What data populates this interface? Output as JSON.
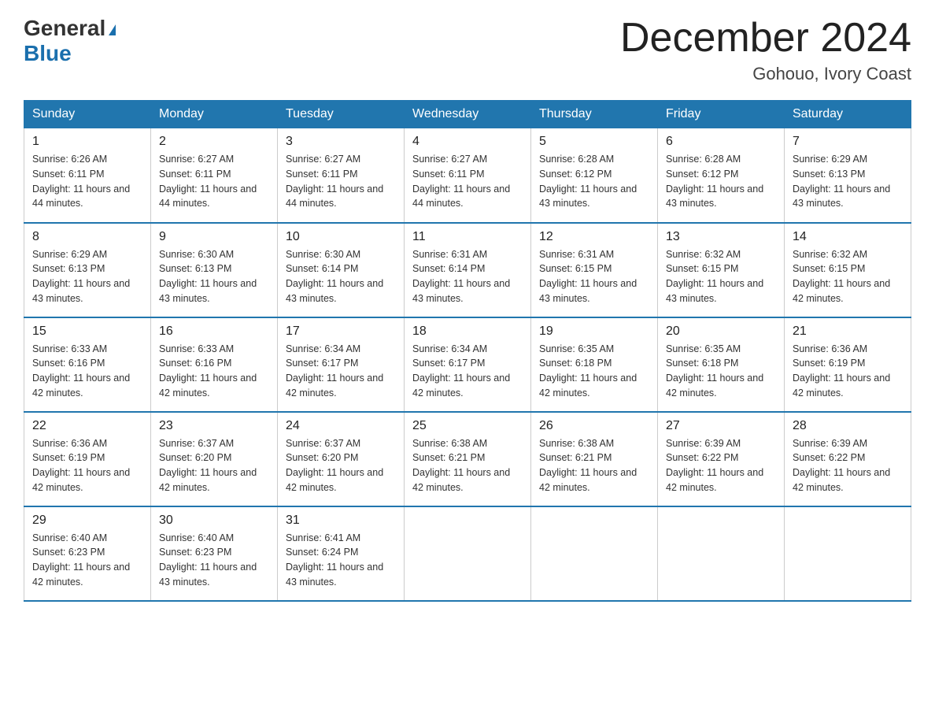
{
  "logo": {
    "general": "General",
    "blue": "Blue",
    "arrow": "▶"
  },
  "title": "December 2024",
  "subtitle": "Gohouo, Ivory Coast",
  "weekdays": [
    "Sunday",
    "Monday",
    "Tuesday",
    "Wednesday",
    "Thursday",
    "Friday",
    "Saturday"
  ],
  "weeks": [
    [
      {
        "day": 1,
        "sunrise": "6:26 AM",
        "sunset": "6:11 PM",
        "daylight": "11 hours and 44 minutes."
      },
      {
        "day": 2,
        "sunrise": "6:27 AM",
        "sunset": "6:11 PM",
        "daylight": "11 hours and 44 minutes."
      },
      {
        "day": 3,
        "sunrise": "6:27 AM",
        "sunset": "6:11 PM",
        "daylight": "11 hours and 44 minutes."
      },
      {
        "day": 4,
        "sunrise": "6:27 AM",
        "sunset": "6:11 PM",
        "daylight": "11 hours and 44 minutes."
      },
      {
        "day": 5,
        "sunrise": "6:28 AM",
        "sunset": "6:12 PM",
        "daylight": "11 hours and 43 minutes."
      },
      {
        "day": 6,
        "sunrise": "6:28 AM",
        "sunset": "6:12 PM",
        "daylight": "11 hours and 43 minutes."
      },
      {
        "day": 7,
        "sunrise": "6:29 AM",
        "sunset": "6:13 PM",
        "daylight": "11 hours and 43 minutes."
      }
    ],
    [
      {
        "day": 8,
        "sunrise": "6:29 AM",
        "sunset": "6:13 PM",
        "daylight": "11 hours and 43 minutes."
      },
      {
        "day": 9,
        "sunrise": "6:30 AM",
        "sunset": "6:13 PM",
        "daylight": "11 hours and 43 minutes."
      },
      {
        "day": 10,
        "sunrise": "6:30 AM",
        "sunset": "6:14 PM",
        "daylight": "11 hours and 43 minutes."
      },
      {
        "day": 11,
        "sunrise": "6:31 AM",
        "sunset": "6:14 PM",
        "daylight": "11 hours and 43 minutes."
      },
      {
        "day": 12,
        "sunrise": "6:31 AM",
        "sunset": "6:15 PM",
        "daylight": "11 hours and 43 minutes."
      },
      {
        "day": 13,
        "sunrise": "6:32 AM",
        "sunset": "6:15 PM",
        "daylight": "11 hours and 43 minutes."
      },
      {
        "day": 14,
        "sunrise": "6:32 AM",
        "sunset": "6:15 PM",
        "daylight": "11 hours and 42 minutes."
      }
    ],
    [
      {
        "day": 15,
        "sunrise": "6:33 AM",
        "sunset": "6:16 PM",
        "daylight": "11 hours and 42 minutes."
      },
      {
        "day": 16,
        "sunrise": "6:33 AM",
        "sunset": "6:16 PM",
        "daylight": "11 hours and 42 minutes."
      },
      {
        "day": 17,
        "sunrise": "6:34 AM",
        "sunset": "6:17 PM",
        "daylight": "11 hours and 42 minutes."
      },
      {
        "day": 18,
        "sunrise": "6:34 AM",
        "sunset": "6:17 PM",
        "daylight": "11 hours and 42 minutes."
      },
      {
        "day": 19,
        "sunrise": "6:35 AM",
        "sunset": "6:18 PM",
        "daylight": "11 hours and 42 minutes."
      },
      {
        "day": 20,
        "sunrise": "6:35 AM",
        "sunset": "6:18 PM",
        "daylight": "11 hours and 42 minutes."
      },
      {
        "day": 21,
        "sunrise": "6:36 AM",
        "sunset": "6:19 PM",
        "daylight": "11 hours and 42 minutes."
      }
    ],
    [
      {
        "day": 22,
        "sunrise": "6:36 AM",
        "sunset": "6:19 PM",
        "daylight": "11 hours and 42 minutes."
      },
      {
        "day": 23,
        "sunrise": "6:37 AM",
        "sunset": "6:20 PM",
        "daylight": "11 hours and 42 minutes."
      },
      {
        "day": 24,
        "sunrise": "6:37 AM",
        "sunset": "6:20 PM",
        "daylight": "11 hours and 42 minutes."
      },
      {
        "day": 25,
        "sunrise": "6:38 AM",
        "sunset": "6:21 PM",
        "daylight": "11 hours and 42 minutes."
      },
      {
        "day": 26,
        "sunrise": "6:38 AM",
        "sunset": "6:21 PM",
        "daylight": "11 hours and 42 minutes."
      },
      {
        "day": 27,
        "sunrise": "6:39 AM",
        "sunset": "6:22 PM",
        "daylight": "11 hours and 42 minutes."
      },
      {
        "day": 28,
        "sunrise": "6:39 AM",
        "sunset": "6:22 PM",
        "daylight": "11 hours and 42 minutes."
      }
    ],
    [
      {
        "day": 29,
        "sunrise": "6:40 AM",
        "sunset": "6:23 PM",
        "daylight": "11 hours and 42 minutes."
      },
      {
        "day": 30,
        "sunrise": "6:40 AM",
        "sunset": "6:23 PM",
        "daylight": "11 hours and 43 minutes."
      },
      {
        "day": 31,
        "sunrise": "6:41 AM",
        "sunset": "6:24 PM",
        "daylight": "11 hours and 43 minutes."
      },
      null,
      null,
      null,
      null
    ]
  ]
}
